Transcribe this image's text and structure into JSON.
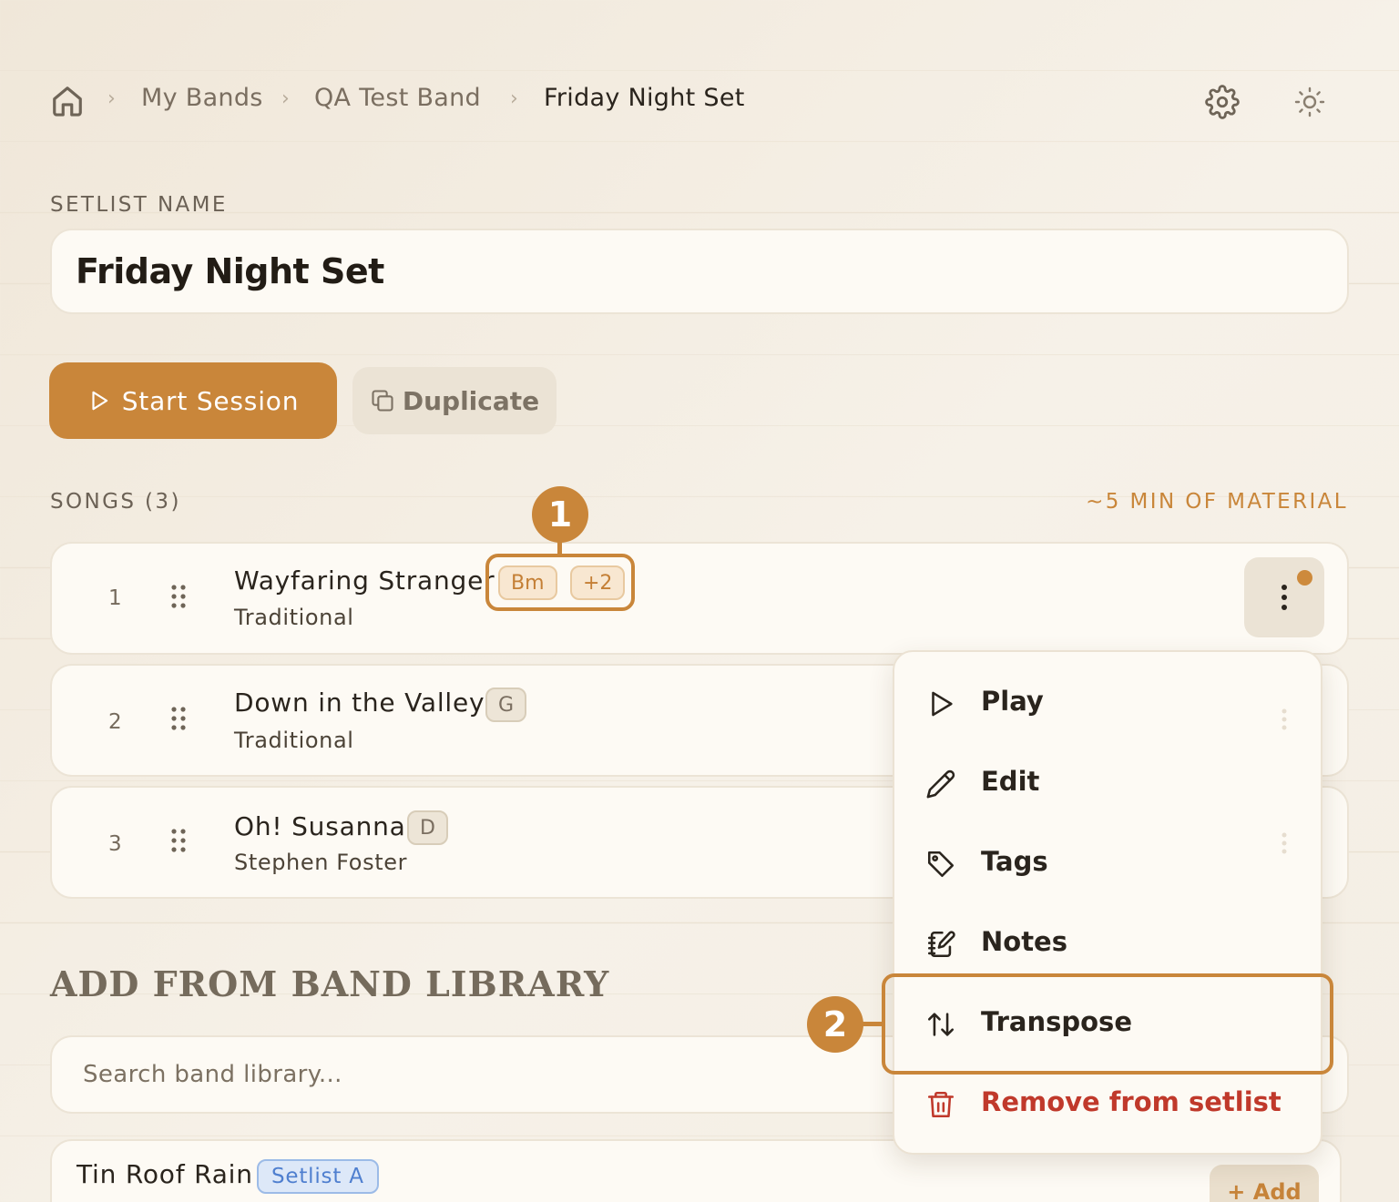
{
  "breadcrumb": {
    "items": [
      "My Bands",
      "QA Test Band"
    ],
    "current": "Friday Night Set"
  },
  "setlist": {
    "label": "SETLIST NAME",
    "name": "Friday Night Set"
  },
  "actions": {
    "start": "Start Session",
    "duplicate": "Duplicate"
  },
  "songs_section": {
    "label": "SONGS (3)",
    "material": "~5 MIN OF MATERIAL"
  },
  "songs": [
    {
      "num": "1",
      "title": "Wayfaring Stranger",
      "artist": "Traditional",
      "key": "Bm",
      "extra": "+2"
    },
    {
      "num": "2",
      "title": "Down in the Valley",
      "artist": "Traditional",
      "key": "G"
    },
    {
      "num": "3",
      "title": "Oh! Susanna",
      "artist": "Stephen Foster",
      "key": "D"
    }
  ],
  "menu": {
    "items": [
      {
        "label": "Play",
        "icon": "play-icon"
      },
      {
        "label": "Edit",
        "icon": "pencil-icon"
      },
      {
        "label": "Tags",
        "icon": "tag-icon"
      },
      {
        "label": "Notes",
        "icon": "notebook-icon"
      },
      {
        "label": "Transpose",
        "icon": "transpose-arrows-icon"
      },
      {
        "label": "Remove from setlist",
        "icon": "trash-icon"
      }
    ]
  },
  "library": {
    "heading": "ADD FROM BAND LIBRARY",
    "search_placeholder": "Search band library...",
    "items": [
      {
        "title": "Tin Roof Rain",
        "badge": "Setlist A",
        "add": "+ Add"
      }
    ]
  },
  "annotations": [
    "1",
    "2"
  ],
  "colors": {
    "accent": "#c9863a",
    "danger": "#c0392b",
    "background": "#f5efe5",
    "card": "#fdfaf4"
  }
}
